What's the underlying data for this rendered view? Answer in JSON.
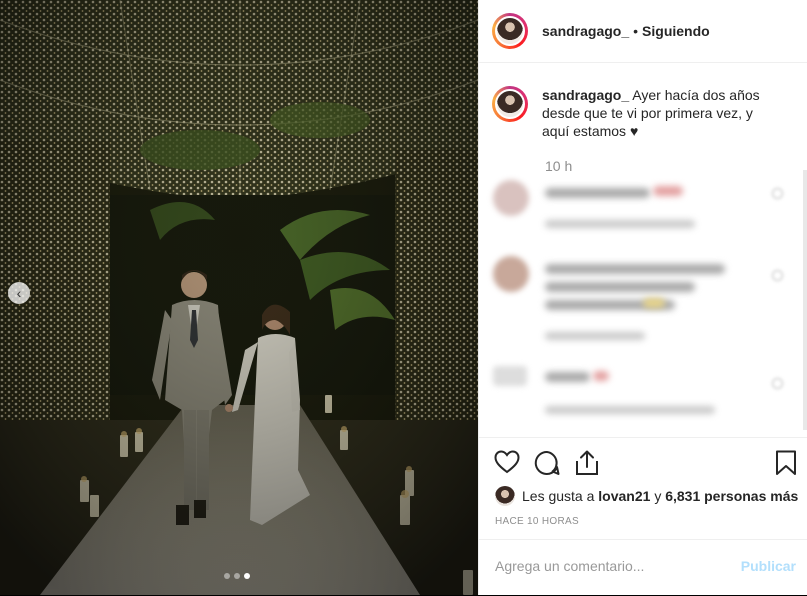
{
  "header": {
    "username": "sandragago_",
    "separator": "•",
    "follow_status": "Siguiendo"
  },
  "caption": {
    "username": "sandragago_",
    "text": "Ayer hacía dos años desde que te vi por primera vez, y aquí estamos ♥",
    "time": "10 h"
  },
  "likes": {
    "prefix": "Les gusta a ",
    "user": "lovan21",
    "middle": " y ",
    "count": "6,831 personas más"
  },
  "timestamp": "HACE 10 HORAS",
  "comment_box": {
    "placeholder": "Agrega un comentario...",
    "publish_label": "Publicar"
  },
  "carousel": {
    "slide_count": 3,
    "active_index": 2
  },
  "colors": {
    "accent_blue": "#b2dffc",
    "text": "#262626",
    "muted": "#8e8e8e"
  }
}
